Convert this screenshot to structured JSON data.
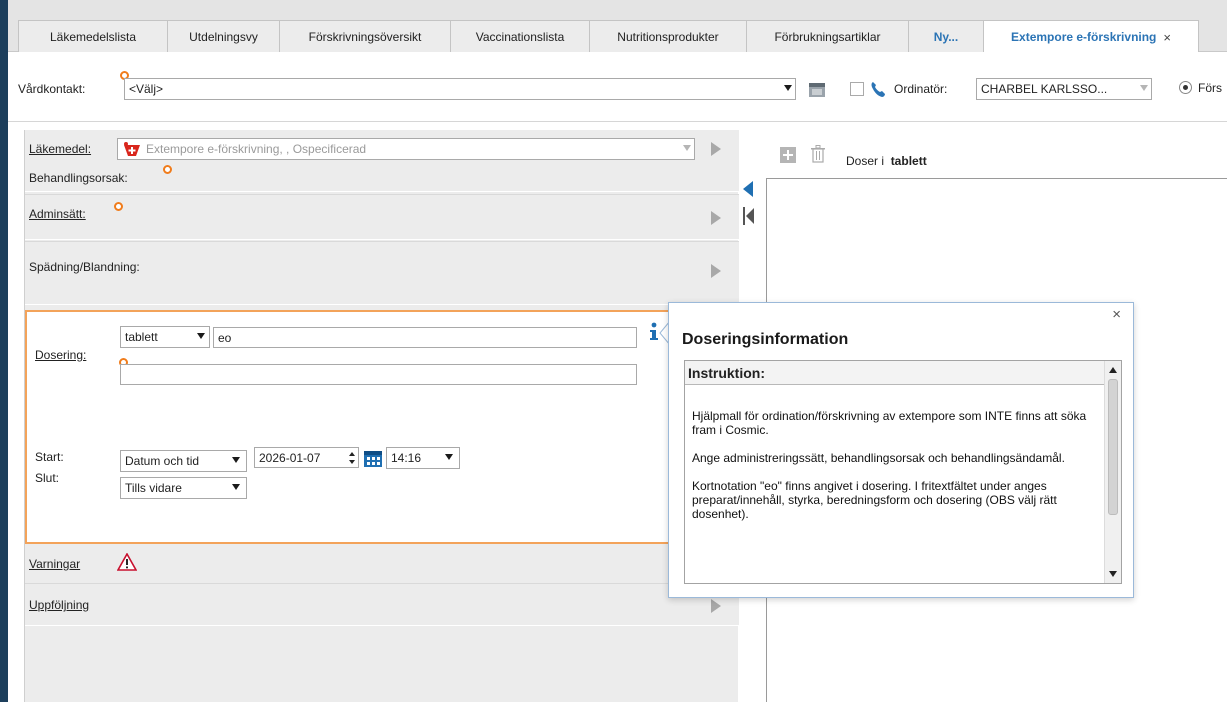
{
  "tabs": [
    {
      "label": "Läkemedelslista"
    },
    {
      "label": "Utdelningsvy"
    },
    {
      "label": "Förskrivningsöversikt"
    },
    {
      "label": "Vaccinationslista"
    },
    {
      "label": "Nutritionsprodukter"
    },
    {
      "label": "Förbrukningsartiklar"
    },
    {
      "label": "Ny..."
    },
    {
      "label": "Extempore e-förskrivning",
      "close": "×"
    }
  ],
  "toolbar": {
    "vardkontakt_label": "Vårdkontakt:",
    "vardkontakt_value": "<Välj>",
    "ordinator_label": "Ordinatör:",
    "ordinator_value": "CHARBEL KARLSSO...",
    "radio_label": "Förs"
  },
  "form": {
    "lakemedel_label": "Läkemedel:",
    "lakemedel_value": "Extempore e-förskrivning, , Ospecificerad",
    "behandlingsorsak_label": "Behandlingsorsak:",
    "adminsatt_label": "Adminsätt:",
    "spadning_label": "Spädning/Blandning:",
    "dosering_label": "Dosering:",
    "dos_unit": "tablett",
    "dos_text": "eo",
    "start_label": "Start:",
    "start_type": "Datum och tid",
    "start_date": "2026-01-07",
    "start_time": "14:16",
    "slut_label": "Slut:",
    "slut_value": "Tills vidare",
    "varningar_label": "Varningar",
    "uppfoljning_label": "Uppföljning"
  },
  "right": {
    "doser_label": "Doser i",
    "doser_unit": "tablett"
  },
  "popup": {
    "title": "Doseringsinformation",
    "close": "×",
    "instr_head": "Instruktion:",
    "p1": "Hjälpmall för ordination/förskrivning av extempore som INTE finns att söka fram i Cosmic.",
    "p2": "Ange administreringssätt, behandlingsorsak och behandlingsändamål.",
    "p3": "Kortnotation \"eo\" finns angivet i dosering. I fritextfältet under anges preparat/innehåll, styrka, beredningsform och dosering (OBS välj rätt dosenhet)."
  },
  "colors": {
    "accent_blue": "#2b74b5",
    "required_orange": "#f07c1b",
    "focus_border": "#f3a35a",
    "warning_red": "#c8102e"
  }
}
